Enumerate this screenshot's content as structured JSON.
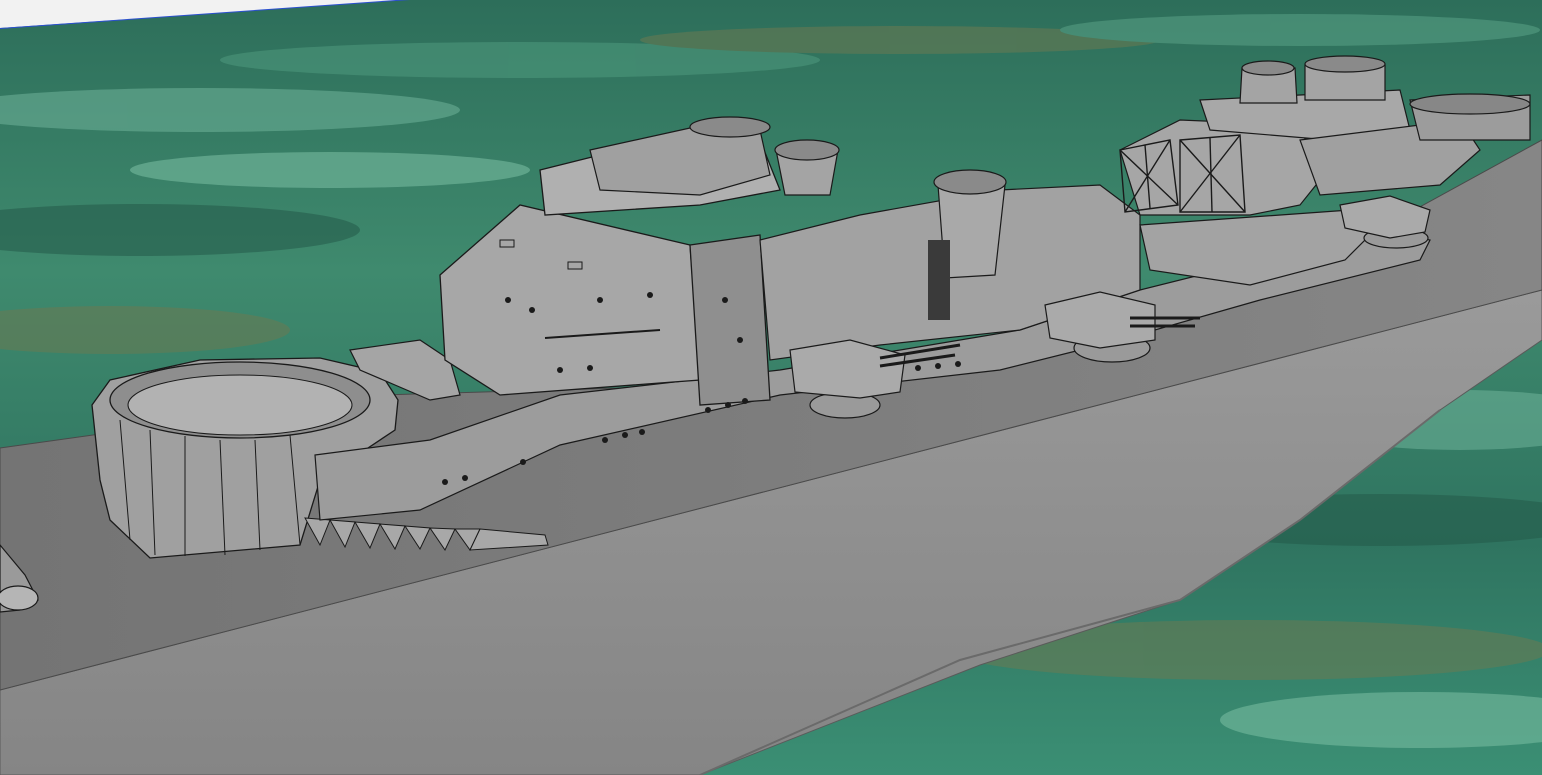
{
  "viewport": {
    "model": "ship-hull-model",
    "colors": {
      "sky": "#f2f2f2",
      "horizon_edge": "#2a4fcf",
      "water_dark": "#245a4a",
      "water_mid": "#3a8a6c",
      "water_light": "#6fb39a",
      "water_brown": "#6b7a52",
      "hull": "#8e8e8e",
      "deck": "#7d7d7d",
      "superstructure": "#a7a7a7",
      "superstructure_shadow": "#8a8a8a",
      "edge": "#1a1a1a"
    }
  }
}
